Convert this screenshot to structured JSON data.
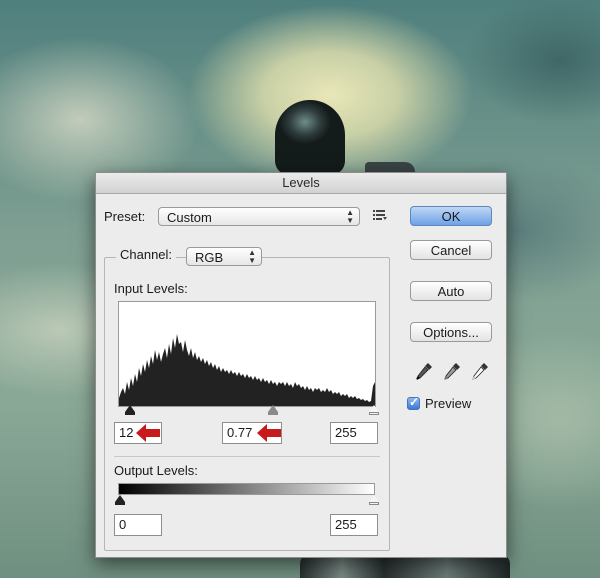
{
  "dialog": {
    "title": "Levels",
    "preset_label": "Preset:",
    "preset_value": "Custom",
    "preset_menu_icon": "list-menu-icon",
    "channel_label": "Channel:",
    "channel_value": "RGB",
    "input_levels_label": "Input Levels:",
    "input_black": "12",
    "input_gamma": "0.77",
    "input_white": "255",
    "output_levels_label": "Output Levels:",
    "output_black": "0",
    "output_white": "255",
    "buttons": {
      "ok": "OK",
      "cancel": "Cancel",
      "auto": "Auto",
      "options": "Options..."
    },
    "eyedroppers": [
      "black-eyedropper-icon",
      "gray-eyedropper-icon",
      "white-eyedropper-icon"
    ],
    "preview_label": "Preview",
    "preview_checked": true,
    "annotation_color": "#c8191c",
    "accent_color": "#6ea1e6"
  }
}
